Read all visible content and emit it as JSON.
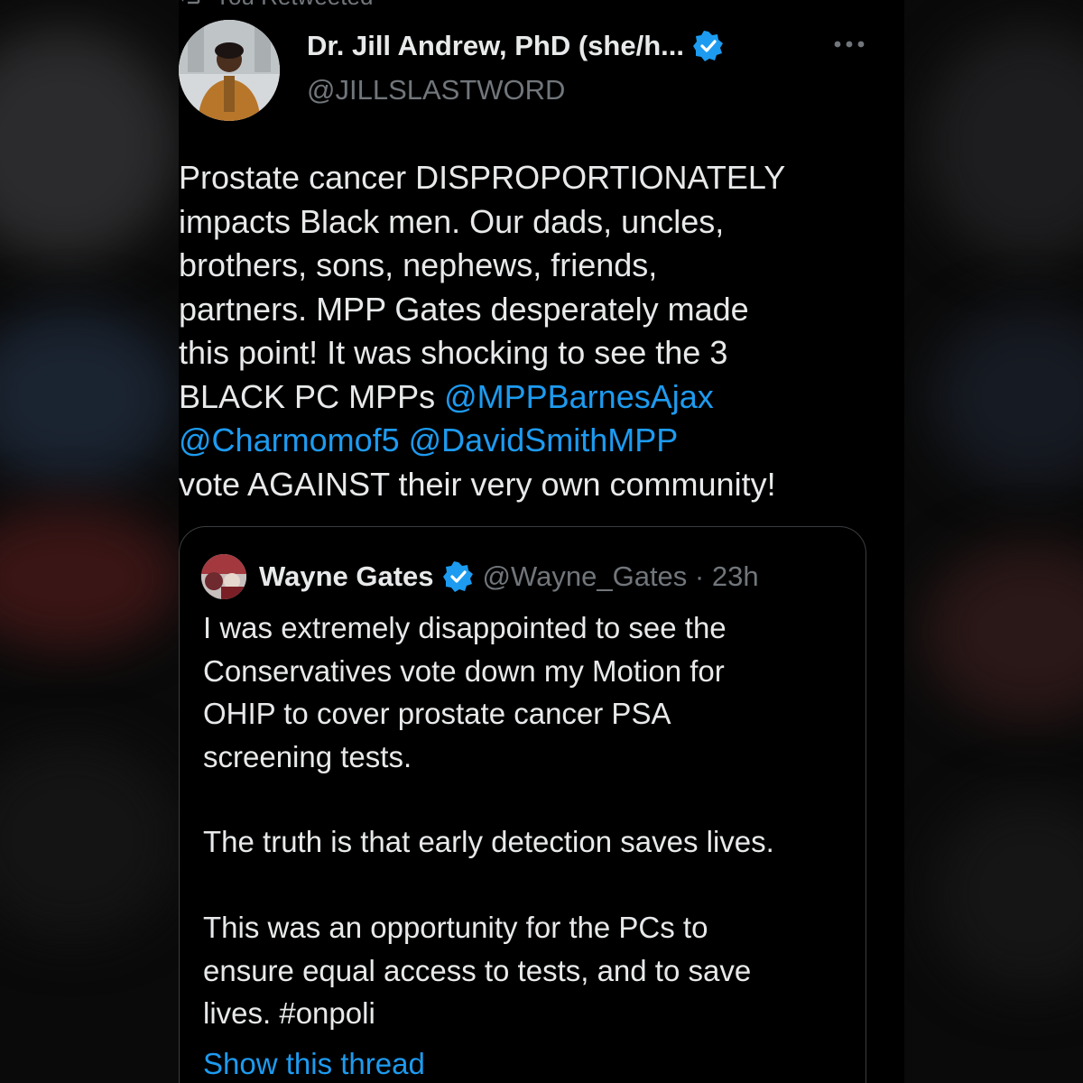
{
  "retweet_banner": {
    "label": "You Retweeted"
  },
  "author": {
    "name": "Dr. Jill Andrew, PhD (she/h...",
    "handle": "@JILLSLASTWORD",
    "verified_icon": "verified-badge-icon"
  },
  "more_icon": "more-options-icon",
  "tweet": {
    "text_1": "Prostate cancer DISPROPORTIONATELY\nimpacts Black men. Our dads, uncles,\nbrothers, sons, nephews, friends,\npartners. MPP Gates desperately made\nthis point! It was shocking to see the 3\nBLACK PC MPPs ",
    "mention_1": "@MPPBarnesAjax",
    "mention_2": "@Charmomof5",
    "mention_3": "@DavidSmithMPP",
    "text_2": "vote AGAINST their very own community!"
  },
  "quote": {
    "name": "Wayne Gates",
    "meta": "@Wayne_Gates · 23h",
    "paragraph_1": "I was extremely disappointed to see the\nConservatives vote down my Motion for\nOHIP to cover prostate cancer PSA\nscreening tests.",
    "paragraph_2": "The truth is that early detection saves lives.",
    "paragraph_3": "This was an opportunity for the PCs to\nensure equal access to tests, and to save\nlives. #onpoli"
  },
  "show_thread": "Show this thread",
  "colors": {
    "background": "#000000",
    "text": "#e7e9ea",
    "secondary": "#71767b",
    "link": "#1d9bf0",
    "border": "#3a3d40"
  }
}
